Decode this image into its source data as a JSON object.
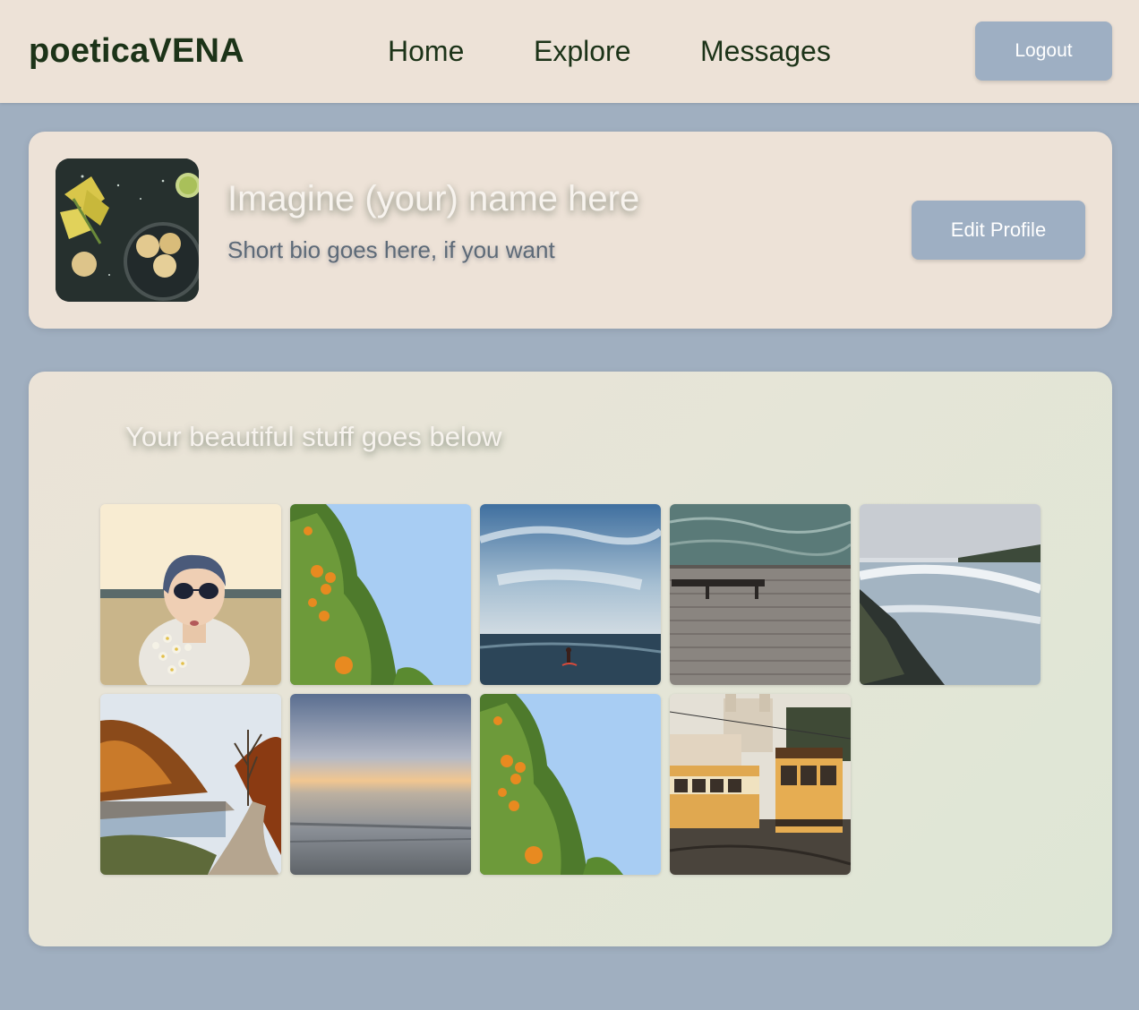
{
  "header": {
    "brand": "poeticaVENA",
    "nav": [
      {
        "label": "Home"
      },
      {
        "label": "Explore"
      },
      {
        "label": "Messages"
      }
    ],
    "logout_label": "Logout"
  },
  "profile": {
    "name": "Imagine (your) name here",
    "bio": "Short bio goes here, if you want",
    "edit_label": "Edit Profile",
    "avatar_icon": "food-still-life-photo"
  },
  "gallery": {
    "title": "Your beautiful stuff goes below",
    "photos": [
      {
        "subject": "woman-with-sunglasses-and-flowers-photo"
      },
      {
        "subject": "orange-tree-against-sky-photo"
      },
      {
        "subject": "surfer-in-ocean-under-clouds-photo"
      },
      {
        "subject": "bench-on-wooden-pier-photo"
      },
      {
        "subject": "waterfall-and-cliffs-photo"
      },
      {
        "subject": "autumn-river-road-photo"
      },
      {
        "subject": "blurred-sea-sunset-photo"
      },
      {
        "subject": "orange-tree-against-sky-photo"
      },
      {
        "subject": "yellow-trams-in-city-photo"
      }
    ]
  },
  "colors": {
    "page_background": "#a0afc0",
    "card_background": "#ede2d7",
    "brand_text": "#1c3318",
    "button_background": "#9eafc3"
  }
}
